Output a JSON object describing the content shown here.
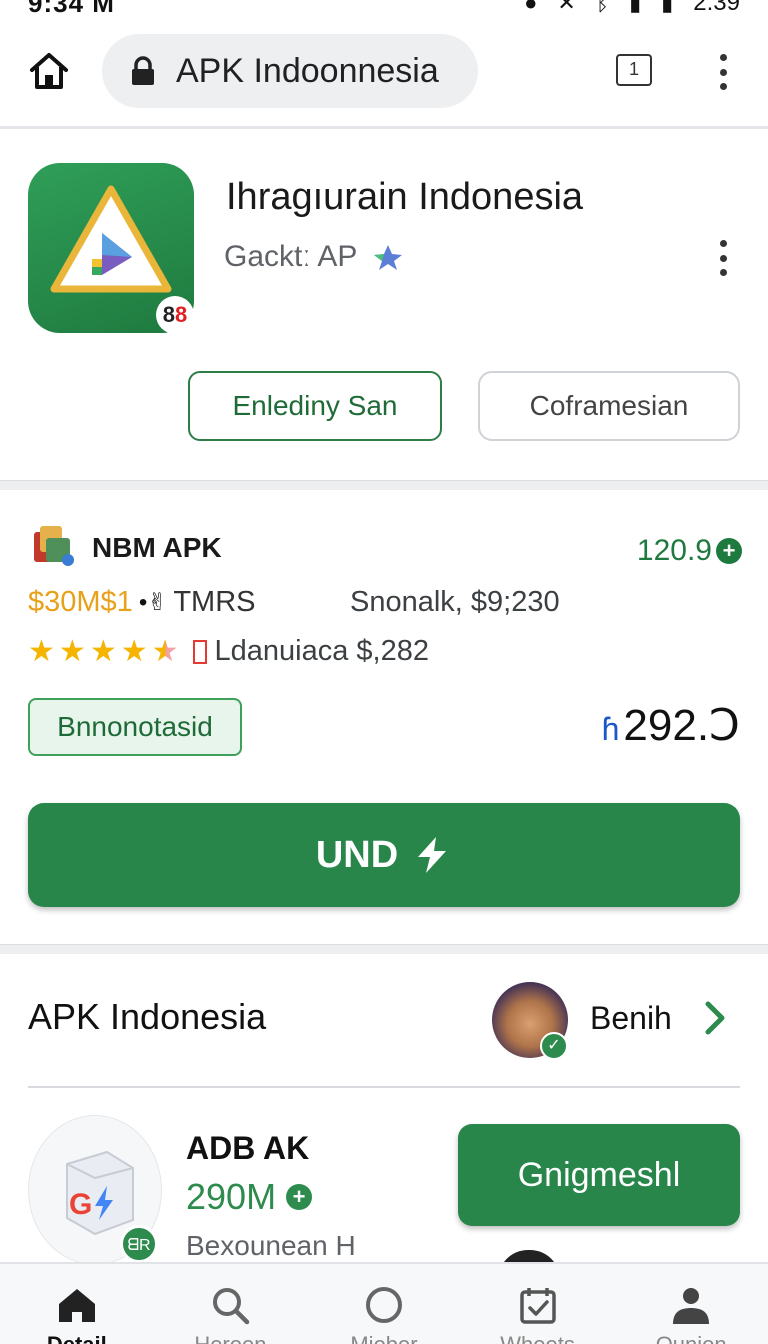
{
  "status_bar": {
    "time": "9:34",
    "carrier_mark": "M",
    "clock_right": "2:39"
  },
  "browser": {
    "url_text": "APK Indoonnesia",
    "tab_count": "1"
  },
  "app": {
    "title": "Ihragıurain Indonesia",
    "subtitle": "Gacktː AP",
    "badge_text": "8",
    "badge_red": "8",
    "primary_outline_button": "Enlediny San",
    "secondary_outline_button": "Coframesian"
  },
  "info_card": {
    "title": "NBM APK",
    "rating_value": "120.9",
    "price_gold": "$30M$1",
    "price_mid": "TMRS",
    "price_right": "Snonalk, $9;230",
    "stars": 4.5,
    "rating_text": "Ldanuiaca $,282",
    "tag_label": "Bnnonotasid",
    "big_prefix": "ɦ",
    "big_number": "292.Ↄ",
    "cta_label": "UND"
  },
  "list": {
    "heading": "APK Indonesia",
    "user_name": "Benih",
    "item": {
      "badge": "ᗺR",
      "title": "ADB AK",
      "size": "290M",
      "desc": "Bexounean H",
      "button": "Gnigmeshl"
    }
  },
  "bottom_nav": {
    "items": [
      {
        "label": "Detail",
        "icon": "home-icon"
      },
      {
        "label": "Heroen",
        "icon": "search-icon"
      },
      {
        "label": "Mieber",
        "icon": "circle-icon"
      },
      {
        "label": "Wheets",
        "icon": "calendar-check-icon"
      },
      {
        "label": "Ounion",
        "icon": "person-icon"
      }
    ]
  },
  "colors": {
    "accent_green": "#28864a",
    "rating_green": "#1f7a3f",
    "gold": "#e8a11a",
    "star": "#f4b400"
  }
}
